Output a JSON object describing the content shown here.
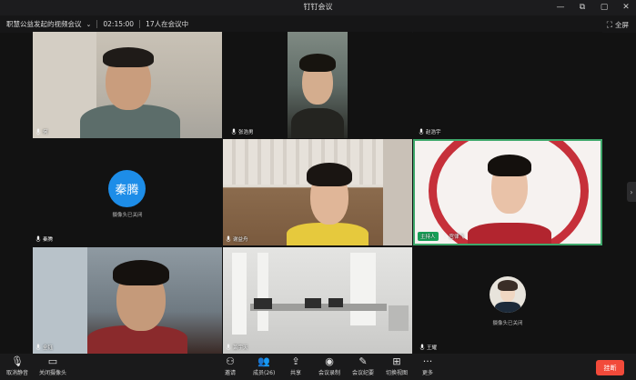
{
  "window": {
    "title": "钉钉会议",
    "controls": [
      "minimize-icon",
      "restore-icon",
      "maximize-icon",
      "close-icon"
    ]
  },
  "infobar": {
    "meeting_name": "职慧公益发起的视频会议",
    "elapsed": "02:15:00",
    "participant_status": "17人在会议中",
    "fullscreen_label": "全屏"
  },
  "tiles": [
    {
      "name": "何",
      "camera": "on"
    },
    {
      "name": "张浩男",
      "camera": "on"
    },
    {
      "name": "赵浩宇",
      "camera": "black"
    },
    {
      "name": "秦腾",
      "camera": "off",
      "avatar_text": "秦腾",
      "off_text": "摄像头已关闭"
    },
    {
      "name": "谢益舟",
      "camera": "on"
    },
    {
      "name": "宫律飞",
      "camera": "on",
      "host_badge": "主持人"
    },
    {
      "name": "全钰",
      "camera": "on"
    },
    {
      "name": "萧宇天",
      "camera": "on"
    },
    {
      "name": "王耀",
      "camera": "off",
      "off_text": "摄像头已关闭"
    }
  ],
  "toolbar": {
    "mute": "取消静音",
    "camera": "关闭摄像头",
    "invite": "邀请",
    "members": "成员(26)",
    "share": "共享",
    "record": "会议录制",
    "minutes": "会议纪要",
    "layout": "切换视图",
    "more": "更多",
    "end": "挂断"
  },
  "colors": {
    "accent": "#1d8de8",
    "end": "#f24a3a",
    "host": "#18a058"
  }
}
